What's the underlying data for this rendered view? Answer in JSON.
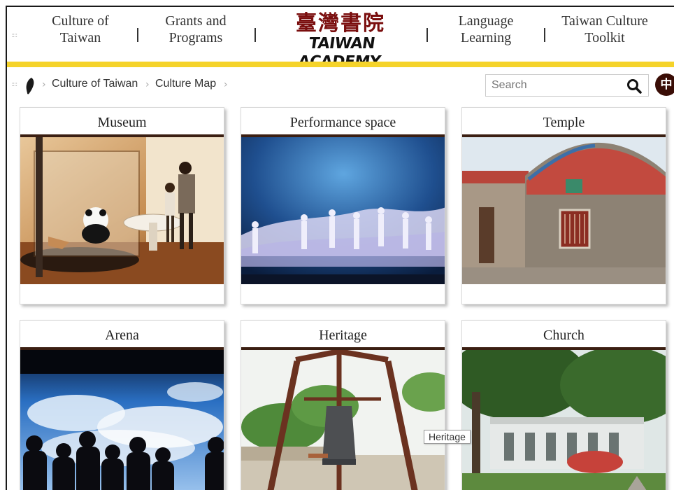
{
  "nav": {
    "items": [
      {
        "line1": "Culture of",
        "line2": "Taiwan"
      },
      {
        "line1": "Grants and",
        "line2": "Programs"
      },
      {
        "line1": "Language",
        "line2": "Learning"
      },
      {
        "line1": "Taiwan Culture",
        "line2": "Toolkit"
      }
    ],
    "logo_cn": "臺灣書院",
    "logo_en": "TAIWAN ACADEMY"
  },
  "breadcrumb": {
    "items": [
      "Culture of Taiwan",
      "Culture Map"
    ]
  },
  "search": {
    "placeholder": "Search",
    "lang_label": "中"
  },
  "cards": [
    {
      "title": "Museum"
    },
    {
      "title": "Performance space"
    },
    {
      "title": "Temple"
    },
    {
      "title": "Arena"
    },
    {
      "title": "Heritage"
    },
    {
      "title": "Church"
    }
  ],
  "tooltip": "Heritage",
  "colors": {
    "accent_yellow": "#f5d32a",
    "title_rule": "#3b1f12",
    "lang_button": "#3a0d06"
  }
}
